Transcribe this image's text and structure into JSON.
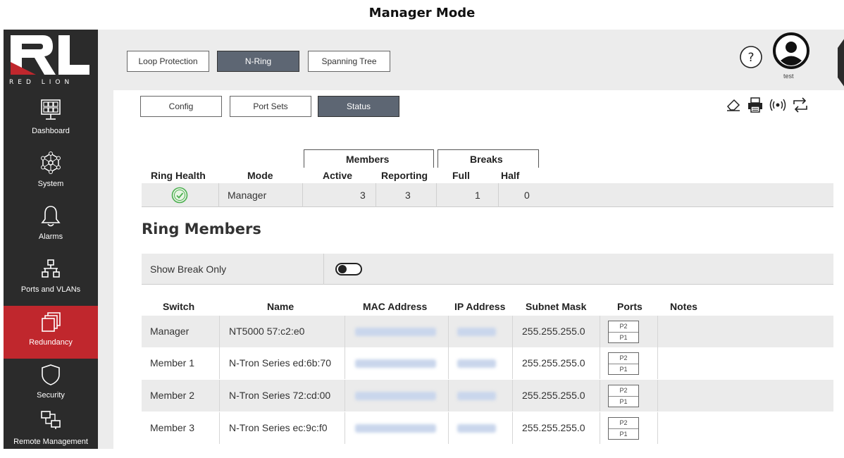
{
  "caption": "Manager Mode",
  "brand": {
    "letters": "RL",
    "wordmark": "RED LION"
  },
  "nav": [
    {
      "label": "Dashboard",
      "icon": "dashboard-icon"
    },
    {
      "label": "System",
      "icon": "system-icon"
    },
    {
      "label": "Alarms",
      "icon": "bell-icon"
    },
    {
      "label": "Ports and VLANs",
      "icon": "network-icon"
    },
    {
      "label": "Redundancy",
      "icon": "redundancy-icon",
      "active": true
    },
    {
      "label": "Security",
      "icon": "shield-icon"
    },
    {
      "label": "Remote Management",
      "icon": "remote-icon"
    }
  ],
  "top_tabs": [
    "Loop Protection",
    "N-Ring",
    "Spanning Tree"
  ],
  "top_tabs_selected": "N-Ring",
  "user": {
    "name": "test"
  },
  "sub_tabs": [
    "Config",
    "Port Sets",
    "Status"
  ],
  "sub_tabs_selected": "Status",
  "status": {
    "group_members": "Members",
    "group_breaks": "Breaks",
    "headers": {
      "ring_health": "Ring Health",
      "mode": "Mode",
      "active": "Active",
      "reporting": "Reporting",
      "full": "Full",
      "half": "Half"
    },
    "values": {
      "mode": "Manager",
      "active": "3",
      "reporting": "3",
      "full": "1",
      "half": "0"
    }
  },
  "ring_members_title": "Ring Members",
  "show_break_only": {
    "label": "Show Break Only",
    "on": false
  },
  "members_table": {
    "headers": [
      "Switch",
      "Name",
      "MAC Address",
      "IP Address",
      "Subnet Mask",
      "Ports",
      "Notes"
    ],
    "rows": [
      {
        "switch": "Manager",
        "name": "NT5000 57:c2:e0",
        "subnet": "255.255.255.0",
        "port_top": "P2",
        "port_bottom": "P1"
      },
      {
        "switch": "Member 1",
        "name": "N-Tron Series ed:6b:70",
        "subnet": "255.255.255.0",
        "port_top": "P2",
        "port_bottom": "P1"
      },
      {
        "switch": "Member 2",
        "name": "N-Tron Series 72:cd:00",
        "subnet": "255.255.255.0",
        "port_top": "P2",
        "port_bottom": "P1"
      },
      {
        "switch": "Member 3",
        "name": "N-Tron Series ec:9c:f0",
        "subnet": "255.255.255.0",
        "port_top": "P2",
        "port_bottom": "P1"
      }
    ]
  },
  "colors": {
    "brand_red": "#c0272d",
    "sidebar": "#2b2b2b",
    "selected_tab": "#5d6673",
    "health_ok": "#4caf50"
  }
}
